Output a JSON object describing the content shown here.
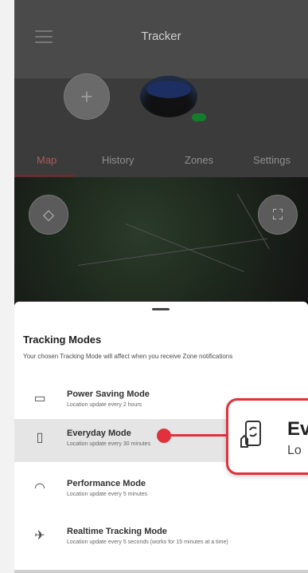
{
  "app": {
    "title": "Tracker"
  },
  "top_actions": {
    "add_icon": "plus-icon",
    "menu_icon": "hamburger-menu-icon"
  },
  "tabs": [
    {
      "label": "Map"
    },
    {
      "label": "History"
    },
    {
      "label": "Zones"
    },
    {
      "label": "Settings"
    }
  ],
  "map": {
    "layers_icon": "layers-icon",
    "fullscreen_icon": "fullscreen-icon"
  },
  "sheet": {
    "title": "Tracking Modes",
    "description": "Your chosen Tracking Mode will affect when you receive Zone notifications",
    "modes": [
      {
        "label": "Power Saving Mode",
        "sub": "Location update every 2 hours",
        "icon": "battery-icon"
      },
      {
        "label": "Everyday Mode",
        "sub": "Location update every 30 minutes",
        "icon": "phone-icon"
      },
      {
        "label": "Performance Mode",
        "sub": "Location update every 5 minutes",
        "icon": "gauge-icon"
      },
      {
        "label": "Realtime Tracking Mode",
        "sub": "Location update every 5 seconds (works for 15 minutes at a time)",
        "icon": "rocket-icon"
      }
    ]
  },
  "callout": {
    "title": "Ev",
    "sub": "Lo",
    "icon": "phone-sync-icon"
  },
  "colors": {
    "accent": "#e0313d",
    "selected_row": "#e5e5e5",
    "map_tab": "#a35d5d"
  }
}
